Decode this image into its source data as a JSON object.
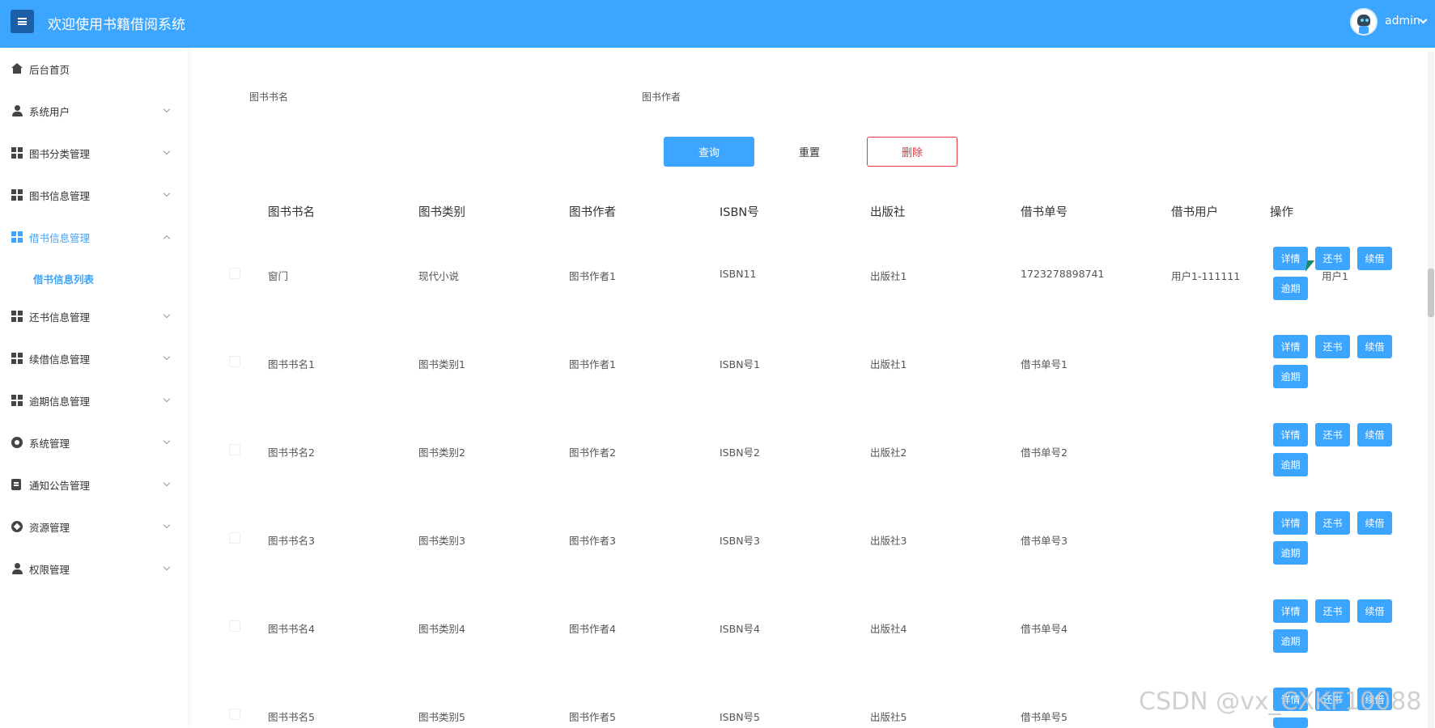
{
  "header": {
    "title": "欢迎使用书籍借阅系统",
    "user": "admin"
  },
  "sidebar": {
    "items": [
      {
        "label": "后台首页",
        "icon": "home-icon"
      },
      {
        "label": "系统用户",
        "icon": "user-icon"
      },
      {
        "label": "图书分类管理",
        "icon": "grid-icon"
      },
      {
        "label": "图书信息管理",
        "icon": "grid-icon"
      },
      {
        "label": "借书信息管理",
        "icon": "grid-icon"
      },
      {
        "label": "还书信息管理",
        "icon": "grid-icon"
      },
      {
        "label": "续借信息管理",
        "icon": "grid-icon"
      },
      {
        "label": "逾期信息管理",
        "icon": "grid-icon"
      },
      {
        "label": "系统管理",
        "icon": "gear-icon"
      },
      {
        "label": "通知公告管理",
        "icon": "document-icon"
      },
      {
        "label": "资源管理",
        "icon": "compass-icon"
      },
      {
        "label": "权限管理",
        "icon": "user-icon"
      }
    ],
    "active_sub_item": "借书信息列表"
  },
  "search": {
    "book_name_label": "图书书名",
    "author_label": "图书作者",
    "query_label": "查询",
    "reset_label": "重置",
    "delete_label": "删除"
  },
  "table": {
    "headers": [
      "图书书名",
      "图书类别",
      "图书作者",
      "ISBN号",
      "出版社",
      "借书单号",
      "借书用户",
      "操作"
    ],
    "rows": [
      {
        "name": "窗门",
        "category": "现代小说",
        "author": "图书作者1",
        "isbn": "ISBN11",
        "publisher": "出版社1",
        "borrow_no": "1723278898741",
        "user": "用户1-111111",
        "user_overlap": "用户1"
      },
      {
        "name": "图书书名1",
        "category": "图书类别1",
        "author": "图书作者1",
        "isbn": "ISBN号1",
        "publisher": "出版社1",
        "borrow_no": "借书单号1",
        "user": ""
      },
      {
        "name": "图书书名2",
        "category": "图书类别2",
        "author": "图书作者2",
        "isbn": "ISBN号2",
        "publisher": "出版社2",
        "borrow_no": "借书单号2",
        "user": ""
      },
      {
        "name": "图书书名3",
        "category": "图书类别3",
        "author": "图书作者3",
        "isbn": "ISBN号3",
        "publisher": "出版社3",
        "borrow_no": "借书单号3",
        "user": ""
      },
      {
        "name": "图书书名4",
        "category": "图书类别4",
        "author": "图书作者4",
        "isbn": "ISBN号4",
        "publisher": "出版社4",
        "borrow_no": "借书单号4",
        "user": ""
      },
      {
        "name": "图书书名5",
        "category": "图书类别5",
        "author": "图书作者5",
        "isbn": "ISBN号5",
        "publisher": "出版社5",
        "borrow_no": "借书单号5",
        "user": ""
      }
    ],
    "actions": {
      "detail": "详情",
      "return": "还书",
      "renew": "续借",
      "overdue": "逾期"
    }
  },
  "watermark": "CSDN @vx_CXKF10088",
  "colors": {
    "accent": "#3ca5ff",
    "danger": "#e0363d"
  }
}
